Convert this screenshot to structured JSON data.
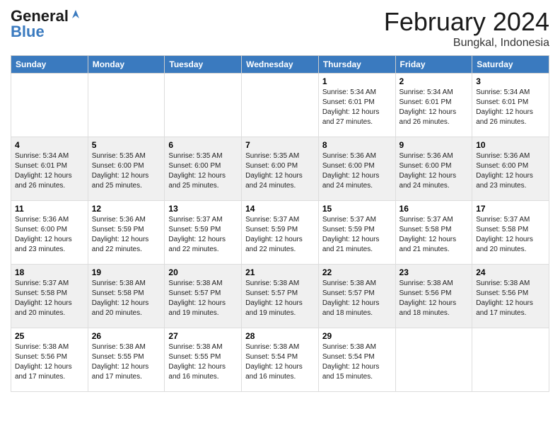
{
  "header": {
    "logo_line1": "General",
    "logo_line2": "Blue",
    "month": "February 2024",
    "location": "Bungkal, Indonesia"
  },
  "days_of_week": [
    "Sunday",
    "Monday",
    "Tuesday",
    "Wednesday",
    "Thursday",
    "Friday",
    "Saturday"
  ],
  "weeks": [
    [
      {
        "day": "",
        "info": ""
      },
      {
        "day": "",
        "info": ""
      },
      {
        "day": "",
        "info": ""
      },
      {
        "day": "",
        "info": ""
      },
      {
        "day": "1",
        "info": "Sunrise: 5:34 AM\nSunset: 6:01 PM\nDaylight: 12 hours\nand 27 minutes."
      },
      {
        "day": "2",
        "info": "Sunrise: 5:34 AM\nSunset: 6:01 PM\nDaylight: 12 hours\nand 26 minutes."
      },
      {
        "day": "3",
        "info": "Sunrise: 5:34 AM\nSunset: 6:01 PM\nDaylight: 12 hours\nand 26 minutes."
      }
    ],
    [
      {
        "day": "4",
        "info": "Sunrise: 5:34 AM\nSunset: 6:01 PM\nDaylight: 12 hours\nand 26 minutes."
      },
      {
        "day": "5",
        "info": "Sunrise: 5:35 AM\nSunset: 6:00 PM\nDaylight: 12 hours\nand 25 minutes."
      },
      {
        "day": "6",
        "info": "Sunrise: 5:35 AM\nSunset: 6:00 PM\nDaylight: 12 hours\nand 25 minutes."
      },
      {
        "day": "7",
        "info": "Sunrise: 5:35 AM\nSunset: 6:00 PM\nDaylight: 12 hours\nand 24 minutes."
      },
      {
        "day": "8",
        "info": "Sunrise: 5:36 AM\nSunset: 6:00 PM\nDaylight: 12 hours\nand 24 minutes."
      },
      {
        "day": "9",
        "info": "Sunrise: 5:36 AM\nSunset: 6:00 PM\nDaylight: 12 hours\nand 24 minutes."
      },
      {
        "day": "10",
        "info": "Sunrise: 5:36 AM\nSunset: 6:00 PM\nDaylight: 12 hours\nand 23 minutes."
      }
    ],
    [
      {
        "day": "11",
        "info": "Sunrise: 5:36 AM\nSunset: 6:00 PM\nDaylight: 12 hours\nand 23 minutes."
      },
      {
        "day": "12",
        "info": "Sunrise: 5:36 AM\nSunset: 5:59 PM\nDaylight: 12 hours\nand 22 minutes."
      },
      {
        "day": "13",
        "info": "Sunrise: 5:37 AM\nSunset: 5:59 PM\nDaylight: 12 hours\nand 22 minutes."
      },
      {
        "day": "14",
        "info": "Sunrise: 5:37 AM\nSunset: 5:59 PM\nDaylight: 12 hours\nand 22 minutes."
      },
      {
        "day": "15",
        "info": "Sunrise: 5:37 AM\nSunset: 5:59 PM\nDaylight: 12 hours\nand 21 minutes."
      },
      {
        "day": "16",
        "info": "Sunrise: 5:37 AM\nSunset: 5:58 PM\nDaylight: 12 hours\nand 21 minutes."
      },
      {
        "day": "17",
        "info": "Sunrise: 5:37 AM\nSunset: 5:58 PM\nDaylight: 12 hours\nand 20 minutes."
      }
    ],
    [
      {
        "day": "18",
        "info": "Sunrise: 5:37 AM\nSunset: 5:58 PM\nDaylight: 12 hours\nand 20 minutes."
      },
      {
        "day": "19",
        "info": "Sunrise: 5:38 AM\nSunset: 5:58 PM\nDaylight: 12 hours\nand 20 minutes."
      },
      {
        "day": "20",
        "info": "Sunrise: 5:38 AM\nSunset: 5:57 PM\nDaylight: 12 hours\nand 19 minutes."
      },
      {
        "day": "21",
        "info": "Sunrise: 5:38 AM\nSunset: 5:57 PM\nDaylight: 12 hours\nand 19 minutes."
      },
      {
        "day": "22",
        "info": "Sunrise: 5:38 AM\nSunset: 5:57 PM\nDaylight: 12 hours\nand 18 minutes."
      },
      {
        "day": "23",
        "info": "Sunrise: 5:38 AM\nSunset: 5:56 PM\nDaylight: 12 hours\nand 18 minutes."
      },
      {
        "day": "24",
        "info": "Sunrise: 5:38 AM\nSunset: 5:56 PM\nDaylight: 12 hours\nand 17 minutes."
      }
    ],
    [
      {
        "day": "25",
        "info": "Sunrise: 5:38 AM\nSunset: 5:56 PM\nDaylight: 12 hours\nand 17 minutes."
      },
      {
        "day": "26",
        "info": "Sunrise: 5:38 AM\nSunset: 5:55 PM\nDaylight: 12 hours\nand 17 minutes."
      },
      {
        "day": "27",
        "info": "Sunrise: 5:38 AM\nSunset: 5:55 PM\nDaylight: 12 hours\nand 16 minutes."
      },
      {
        "day": "28",
        "info": "Sunrise: 5:38 AM\nSunset: 5:54 PM\nDaylight: 12 hours\nand 16 minutes."
      },
      {
        "day": "29",
        "info": "Sunrise: 5:38 AM\nSunset: 5:54 PM\nDaylight: 12 hours\nand 15 minutes."
      },
      {
        "day": "",
        "info": ""
      },
      {
        "day": "",
        "info": ""
      }
    ]
  ]
}
